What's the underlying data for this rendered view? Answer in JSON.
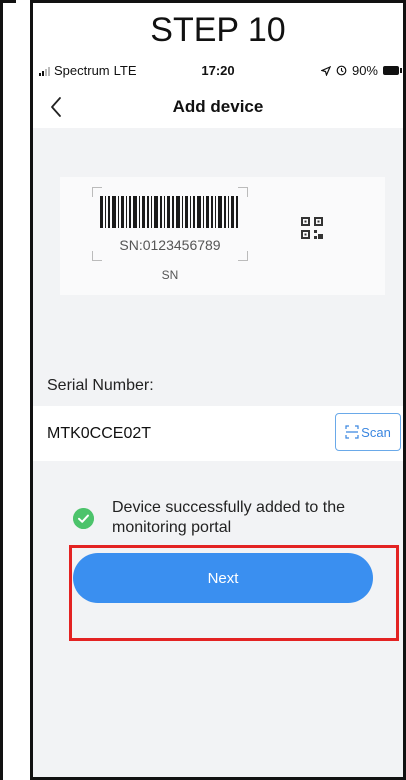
{
  "step_title": "STEP 10",
  "status_bar": {
    "carrier": "Spectrum",
    "network": "LTE",
    "time": "17:20",
    "battery": "90%"
  },
  "nav": {
    "title": "Add device",
    "back_icon": "chevron-left-icon"
  },
  "sn_card": {
    "sn_code": "SN:0123456789",
    "caption": "SN"
  },
  "serial": {
    "label": "Serial Number:",
    "value": "MTK0CCE02T",
    "scan_label": "Scan"
  },
  "status": {
    "message": "Device successfully added to the monitoring portal"
  },
  "next_button": {
    "label": "Next"
  },
  "colors": {
    "accent": "#3a8ff0",
    "success": "#4cc36b",
    "highlight": "#e32222"
  }
}
